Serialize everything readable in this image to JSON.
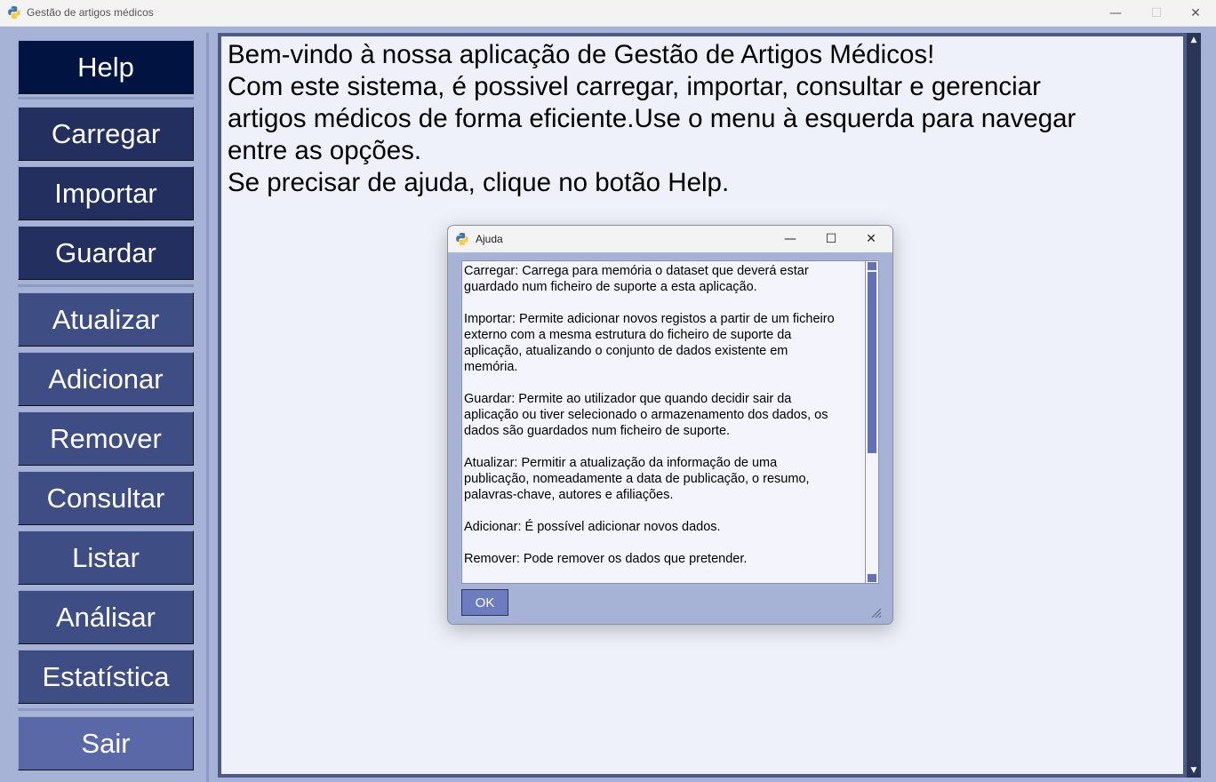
{
  "window": {
    "title": "Gestão de artigos médicos",
    "minimize_glyph": "—",
    "maximize_glyph": "☐",
    "close_glyph": "✕"
  },
  "sidebar": {
    "items": [
      {
        "label": "Help",
        "color": "#011441"
      },
      {
        "label": "Carregar",
        "color": "#232f5e"
      },
      {
        "label": "Importar",
        "color": "#232f5e"
      },
      {
        "label": "Guardar",
        "color": "#232f5e"
      },
      {
        "label": "Atualizar",
        "color": "#3e4d84"
      },
      {
        "label": "Adicionar",
        "color": "#3e4d84"
      },
      {
        "label": "Remover",
        "color": "#3e4d84"
      },
      {
        "label": "Consultar",
        "color": "#3e4d84"
      },
      {
        "label": "Listar",
        "color": "#3e4d84"
      },
      {
        "label": "Análisar",
        "color": "#3e4d84"
      },
      {
        "label": "Estatística",
        "color": "#3e4d84"
      },
      {
        "label": "Sair",
        "color": "#5a68a8"
      }
    ]
  },
  "main": {
    "welcome_text": "Bem-vindo à nossa aplicação de Gestão de Artigos Médicos!\nCom este sistema, é possivel carregar, importar, consultar e gerenciar\nartigos médicos de forma eficiente.Use o menu à esquerda para navegar\nentre as opções.\nSe precisar de ajuda, clique no botão Help."
  },
  "dialog": {
    "title": "Ajuda",
    "body": "Carregar: Carrega para memória o dataset que deverá estar\nguardado num ficheiro de suporte a esta aplicação.\n\nImportar: Permite adicionar novos registos a partir de um ficheiro\nexterno com a mesma estrutura do ficheiro de suporte da\naplicação, atualizando o conjunto de dados existente em\nmemória.\n\nGuardar: Permite ao utilizador que quando decidir sair da\naplicação ou tiver selecionado o armazenamento dos dados, os\ndados são guardados num ficheiro de suporte.\n\nAtualizar: Permitir a atualização da informação de uma\npublicação, nomeadamente a data de publicação, o resumo,\npalavras-chave, autores e afiliações.\n\nAdicionar: É possível adicionar novos dados.\n\nRemover: Pode remover os dados que pretender.",
    "ok_label": "OK",
    "minimize_glyph": "—",
    "maximize_glyph": "☐",
    "close_glyph": "✕"
  }
}
